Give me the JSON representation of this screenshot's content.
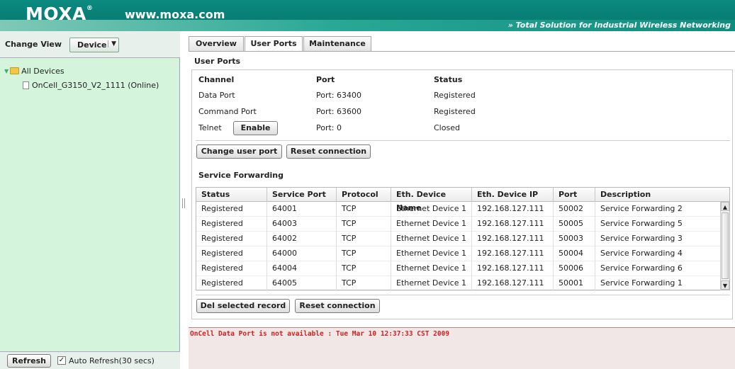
{
  "header": {
    "logo": "MOXA",
    "reg": "®",
    "url": "www.moxa.com",
    "tagline": "» Total Solution for Industrial Wireless Networking",
    "colors": {
      "header_bg": "#0a8a80",
      "left_panel_bg": "#d4f4dc",
      "log_text": "#d12020"
    }
  },
  "sidebar": {
    "change_view_label": "Change View",
    "view_select_value": "Device",
    "tree": {
      "root_label": "All Devices",
      "device_label": "OnCell_G3150_V2_1111 (Online)"
    },
    "refresh_label": "Refresh",
    "auto_refresh_label": "Auto Refresh(30 secs)",
    "auto_refresh_checked": "✓"
  },
  "tabs": [
    {
      "label": "Overview"
    },
    {
      "label": "User Ports"
    },
    {
      "label": "Maintenance"
    }
  ],
  "user_ports": {
    "section_title": "User Ports",
    "columns": {
      "channel": "Channel",
      "port": "Port",
      "status": "Status"
    },
    "rows": [
      {
        "channel": "Data Port",
        "port": "Port: 63400",
        "status": "Registered"
      },
      {
        "channel": "Command Port",
        "port": "Port: 63600",
        "status": "Registered"
      },
      {
        "channel": "Telnet",
        "port": "Port: 0",
        "status": "Closed"
      }
    ],
    "telnet_enable_label": "Enable",
    "change_port_label": "Change user port",
    "reset_label": "Reset connection"
  },
  "service_forwarding": {
    "title": "Service Forwarding",
    "headers": [
      "Status",
      "Service Port",
      "Protocol",
      "Eth. Device Name",
      "Eth. Device IP",
      "Port",
      "Description"
    ],
    "rows": [
      [
        "Registered",
        "64001",
        "TCP",
        "Ethernet Device 1",
        "192.168.127.111",
        "50002",
        "Service Forwarding 2"
      ],
      [
        "Registered",
        "64003",
        "TCP",
        "Ethernet Device 1",
        "192.168.127.111",
        "50005",
        "Service Forwarding 5"
      ],
      [
        "Registered",
        "64002",
        "TCP",
        "Ethernet Device 1",
        "192.168.127.111",
        "50003",
        "Service Forwarding 3"
      ],
      [
        "Registered",
        "64000",
        "TCP",
        "Ethernet Device 1",
        "192.168.127.111",
        "50004",
        "Service Forwarding 4"
      ],
      [
        "Registered",
        "64004",
        "TCP",
        "Ethernet Device 1",
        "192.168.127.111",
        "50006",
        "Service Forwarding 6"
      ],
      [
        "Registered",
        "64005",
        "TCP",
        "Ethernet Device 1",
        "192.168.127.111",
        "50001",
        "Service Forwarding 1"
      ]
    ],
    "del_label": "Del selected record",
    "reset_label": "Reset connection"
  },
  "log": {
    "message": "OnCell Data Port is not available : Tue Mar 10 12:37:33 CST 2009"
  }
}
